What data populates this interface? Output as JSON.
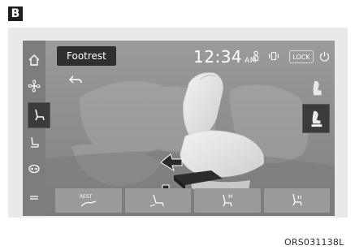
{
  "figure": {
    "badge": "B",
    "caption": "ORS031138L"
  },
  "screen": {
    "title": "Footrest",
    "time": "12:34",
    "ampm": "AM",
    "lock_label": "LOCK",
    "sidebar": {
      "items": [
        {
          "icon": "home-icon"
        },
        {
          "icon": "fan-icon"
        },
        {
          "icon": "seat-icon",
          "active": true
        },
        {
          "icon": "seat-back-icon"
        },
        {
          "icon": "massage-icon"
        },
        {
          "icon": "menu-icon"
        }
      ]
    },
    "right_buttons": [
      {
        "icon": "seat-side-icon",
        "active": false
      },
      {
        "icon": "footrest-icon",
        "active": true
      }
    ],
    "bottom_buttons": [
      {
        "icon": "rest-mode-icon",
        "label": "REST"
      },
      {
        "icon": "seat-recline-icon",
        "label": ""
      },
      {
        "icon": "seat-memory-icon",
        "label": "M"
      },
      {
        "icon": "seat-heat-icon",
        "label": ""
      }
    ],
    "colors": {
      "screen_bg": "#8f8f8f",
      "active_bg": "#3b3b3b"
    }
  }
}
